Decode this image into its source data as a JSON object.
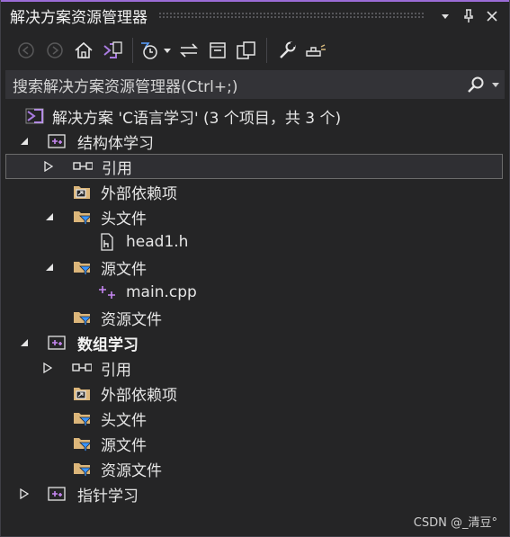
{
  "window": {
    "title": "解决方案资源管理器"
  },
  "title_buttons": {
    "dropdown": "▾",
    "pin": "📌",
    "close": "✕"
  },
  "search": {
    "placeholder": "搜索解决方案资源管理器(Ctrl+;)"
  },
  "tree": {
    "solution": "解决方案 'C语言学习' (3 个项目，共 3 个)",
    "projects": [
      {
        "name": "结构体学习",
        "items": [
          "引用",
          "外部依赖项",
          "头文件",
          "head1.h",
          "源文件",
          "main.cpp",
          "资源文件"
        ]
      },
      {
        "name": "数组学习",
        "items": [
          "引用",
          "外部依赖项",
          "头文件",
          "源文件",
          "资源文件"
        ]
      },
      {
        "name": "指针学习",
        "items": []
      }
    ]
  },
  "watermark": "CSDN @_清豆°",
  "colors": {
    "accent": "#9b6cd6",
    "background": "#252526",
    "search_bg": "#333337",
    "selection_border": "#6b6b6b"
  }
}
